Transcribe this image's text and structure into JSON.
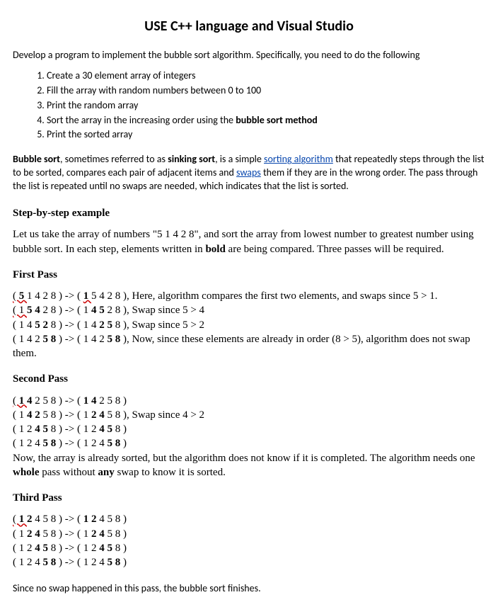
{
  "title": "USE C++ language and Visual Studio",
  "intro": "Develop a program to implement the bubble sort algorithm. Specifically, you need to do the following",
  "steps": {
    "s1": "Create a 30 element array of integers",
    "s2": "Fill the array with random numbers between 0 to 100",
    "s3": "Print the random array",
    "s4_pre": "Sort the array in the increasing order using the ",
    "s4_bold": "bubble sort method",
    "s5": "Print the sorted array"
  },
  "bubble": {
    "b1": "Bubble sort",
    "t1": ", sometimes referred to as ",
    "b2": "sinking sort",
    "t2": ", is a simple ",
    "link1": "sorting algorithm",
    "t3": " that repeatedly steps through the list to be sorted, compares each pair of adjacent items and ",
    "link2": "swaps",
    "t4": " them if they are in the wrong order. The pass through the list is repeated until no swaps are needed, which indicates that the list is sorted."
  },
  "step_head": "Step-by-step example",
  "step_para_pre": "Let us take the array of numbers \"5 1 4 2 8\", and sort the array from lowest number to greatest number using bubble sort. In each step, elements written in ",
  "step_para_bold": "bold",
  "step_para_post": " are being compared. Three passes will be required.",
  "pass1_head": "First Pass",
  "pass2_head": "Second Pass",
  "pass3_head": "Third Pass",
  "p1": {
    "l1a": "( ",
    "l1b": "5 ",
    "l1c": "1 4 2 8 ) -> ( ",
    "l1d": "1 ",
    "l1e": "5 4 2 8 ), Here, algorithm compares the first two elements, and swaps since 5 > 1.",
    "l2a": "( ",
    "l2b": "1 ",
    "l2c": "5 4 ",
    "l2d": "2 8 ) -> ( 1 ",
    "l2e": "4 5 ",
    "l2f": "2 8 ), Swap since 5 > 4",
    "l3a": "( 1 4 ",
    "l3b": "5 2 ",
    "l3c": "8 ) -> ( 1 4 ",
    "l3d": "2 5 ",
    "l3e": "8 ), Swap since 5 > 2",
    "l4a": "( 1 4 2 ",
    "l4b": "5 8 ",
    "l4c": ") -> ( 1 4 2 ",
    "l4d": "5 8 ",
    "l4e": "), Now, since these elements are already in order (8 > 5), algorithm does not swap them."
  },
  "p2": {
    "l1a": "( ",
    "l1b": "1 ",
    "l1c": "4 ",
    "l1d": "2 5 8 )  -> ( ",
    "l1e": "1 4 ",
    "l1f": "2 5 8 )",
    "l2a": "( 1 ",
    "l2b": "4 2 ",
    "l2c": "5 8 )  -> ( 1 ",
    "l2d": "2 4 ",
    "l2e": "5 8 ), Swap since 4 > 2",
    "l3a": "( 1 2 ",
    "l3b": "4 5 ",
    "l3c": "8 )  -> ( 1 2 ",
    "l3d": "4 5 ",
    "l3e": "8 )",
    "l4a": "( 1 2 4 ",
    "l4b": "5 8 ",
    "l4c": ")  -> ( 1 2 4 ",
    "l4d": "5 8 ",
    "l4e": ")",
    "note_pre": "Now, the array is already sorted, but the algorithm does not know if it is completed. The algorithm needs one ",
    "note_b1": "whole",
    "note_mid": " pass without ",
    "note_b2": "any",
    "note_post": " swap to know it is sorted."
  },
  "p3": {
    "l1a": "( ",
    "l1b": "1 ",
    "l1c": "2 ",
    "l1d": "4 5 8 )  ->  ( ",
    "l1e": "1 2 ",
    "l1f": "4 5 8 )",
    "l2a": "( 1 ",
    "l2b": "2 4 ",
    "l2c": "5 8 )  -> ( 1 ",
    "l2d": "2 4 ",
    "l2e": "5 8 )",
    "l3a": "( 1 2 ",
    "l3b": "4 5 ",
    "l3c": "8 )  -> ( 1 2 ",
    "l3d": "4 5 ",
    "l3e": "8 )",
    "l4a": "( 1 2 4 ",
    "l4b": "5 8 ",
    "l4c": ")  -> ( 1 2 4 ",
    "l4d": "5 8 ",
    "l4e": ")"
  },
  "final": "Since no swap happened in this pass, the bubble sort finishes."
}
